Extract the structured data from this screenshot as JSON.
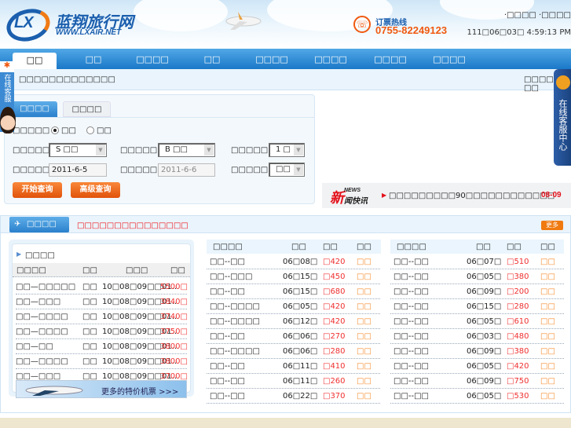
{
  "header": {
    "logo_mark": "LX",
    "site_name": "蓝翔旅行网",
    "site_url": "WWW.LXAIR.NET",
    "hotline_label": "订票热线",
    "hotline": "0755-82249123",
    "top_links": "·□□□□ ·□□□□",
    "clock": "111□06□03□ 4:59:13 PM"
  },
  "nav": {
    "items": [
      "□□",
      "□□",
      "□□□□",
      "□□",
      "□□□□",
      "□□□□",
      "□□□□",
      "□□□□"
    ]
  },
  "subbar": {
    "notice": "□□□□□□□□□□□□□",
    "links": "□□□□ | □□"
  },
  "search": {
    "tabs": [
      "□□□□",
      "□□□□"
    ],
    "trip_label": "□□□□□",
    "trip_options": [
      "□□",
      "□□"
    ],
    "from_label": "□□□□□",
    "from_value": "S □□",
    "to_label": "□□□□□",
    "to_value": "B □□",
    "pax_label": "□□□□□",
    "pax_value": "1 □",
    "depart_label": "□□□□□",
    "depart_value": "2011-6-5",
    "return_label": "□□□□□",
    "return_value": "2011-6-6",
    "class_label": "□□□□□",
    "class_value": "□□",
    "search_button": "开始查询",
    "advanced_button": "高级查询"
  },
  "news": {
    "logo_big": "新",
    "logo_en": "NEWS",
    "logo_small": "闻快讯",
    "text": "□□□□□□□□□90□□□□□□□□□□□□",
    "date": "08-09"
  },
  "float_left": {
    "label": "在线客服"
  },
  "float_right": {
    "label": "在线客服中心"
  },
  "special": {
    "tab": "□□□□",
    "promo": "□□□□□□□□□□□□□□□",
    "more": "更多",
    "intl": {
      "title": "□□□□",
      "headers": [
        "□□□□",
        "□□",
        "□□□",
        "□□"
      ],
      "rows": [
        [
          "□□—□□□□□",
          "□□",
          "10□08□09□□01..",
          "5500□"
        ],
        [
          "□□—□□□",
          "□□",
          "10□08□09□□01..",
          "3840□"
        ],
        [
          "□□—□□□□",
          "□□",
          "10□08□09□□01..",
          "3740□"
        ],
        [
          "□□—□□□□",
          "□□",
          "10□08□09□□01..",
          "3750□"
        ],
        [
          "□□—□□",
          "□□",
          "10□08□09□□01..",
          "3800□"
        ],
        [
          "□□—□□□□",
          "□□",
          "10□08□09□□01..",
          "3800□"
        ],
        [
          "□□—□□□",
          "□□",
          "10□08□09□□01..",
          "3700□"
        ]
      ],
      "banner": "更多的特价机票 >>>"
    },
    "domestic_a": {
      "headers": [
        "□□□□",
        "□□",
        "□□",
        "□□"
      ],
      "rows": [
        [
          "□□--□□",
          "06□08□",
          "□420",
          "□□"
        ],
        [
          "□□--□□□",
          "06□15□",
          "□450",
          "□□"
        ],
        [
          "□□--□□",
          "06□15□",
          "□680",
          "□□"
        ],
        [
          "□□--□□□□",
          "06□05□",
          "□420",
          "□□"
        ],
        [
          "□□--□□□□",
          "06□12□",
          "□420",
          "□□"
        ],
        [
          "□□--□□",
          "06□06□",
          "□270",
          "□□"
        ],
        [
          "□□--□□□□",
          "06□06□",
          "□280",
          "□□"
        ],
        [
          "□□--□□",
          "06□11□",
          "□410",
          "□□"
        ],
        [
          "□□--□□",
          "06□11□",
          "□260",
          "□□"
        ],
        [
          "□□--□□",
          "06□22□",
          "□370",
          "□□"
        ]
      ]
    },
    "domestic_b": {
      "headers": [
        "□□□□",
        "□□",
        "□□",
        "□□"
      ],
      "rows": [
        [
          "□□--□□",
          "06□07□",
          "□510",
          "□□"
        ],
        [
          "□□--□□",
          "06□05□",
          "□380",
          "□□"
        ],
        [
          "□□--□□",
          "06□09□",
          "□200",
          "□□"
        ],
        [
          "□□--□□",
          "06□15□",
          "□280",
          "□□"
        ],
        [
          "□□--□□",
          "06□05□",
          "□610",
          "□□"
        ],
        [
          "□□--□□",
          "06□03□",
          "□480",
          "□□"
        ],
        [
          "□□--□□",
          "06□09□",
          "□380",
          "□□"
        ],
        [
          "□□--□□",
          "06□05□",
          "□420",
          "□□"
        ],
        [
          "□□--□□",
          "06□09□",
          "□750",
          "□□"
        ],
        [
          "□□--□□",
          "06□05□",
          "□530",
          "□□"
        ]
      ]
    }
  }
}
